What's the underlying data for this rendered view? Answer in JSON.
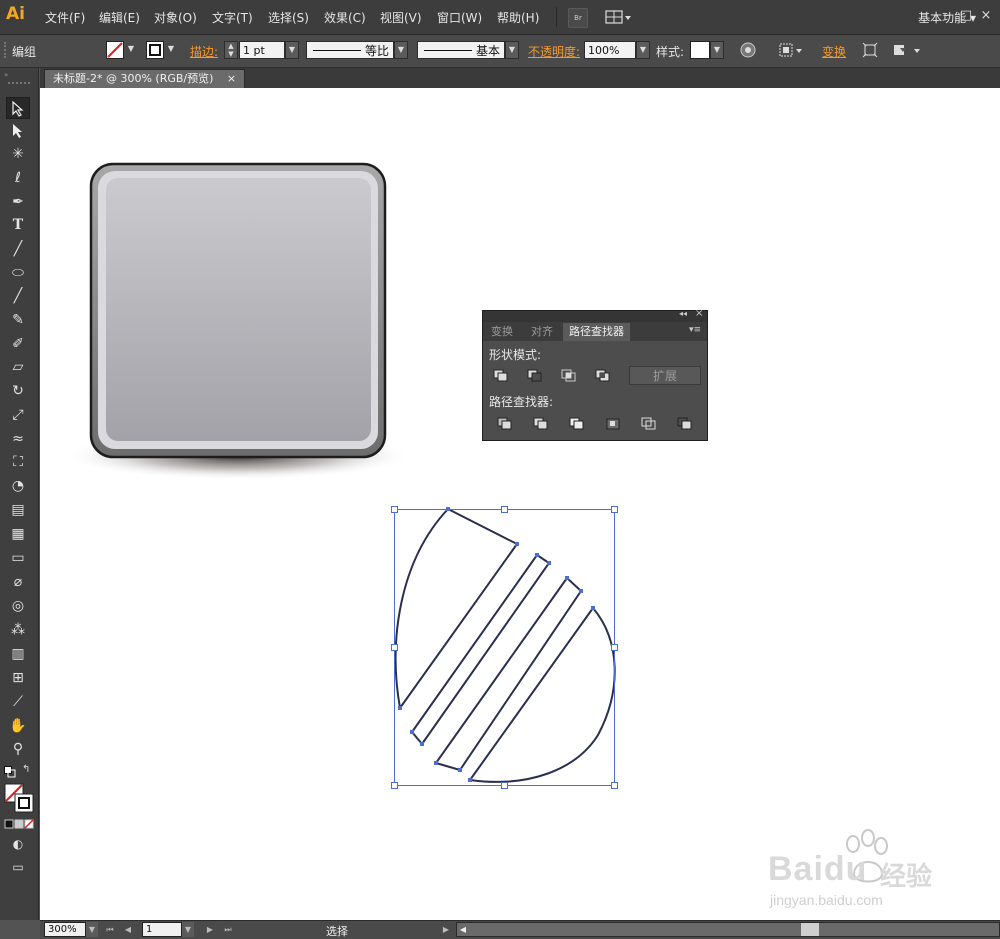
{
  "app": {
    "logo": "Ai",
    "workspace": "基本功能"
  },
  "menu": [
    "文件(F)",
    "编辑(E)",
    "对象(O)",
    "文字(T)",
    "选择(S)",
    "效果(C)",
    "视图(V)",
    "窗口(W)",
    "帮助(H)"
  ],
  "toolbar_icons": {
    "bridge": "Br",
    "arrange": "arrange-documents-icon"
  },
  "control": {
    "selection": "编组",
    "stroke_label": "描边:",
    "stroke_weight": "1 pt",
    "profile_ratio": "等比",
    "brush": "基本",
    "opacity_label": "不透明度:",
    "opacity_value": "100%",
    "style_label": "样式:",
    "transform_label": "变换"
  },
  "document": {
    "tab_title": "未标题-2* @ 300% (RGB/预览)",
    "close": "×"
  },
  "pathfinder_panel": {
    "tabs": [
      "变换",
      "对齐",
      "路径查找器"
    ],
    "active_tab": "路径查找器",
    "shape_modes_label": "形状模式:",
    "expand_label": "扩展",
    "pathfinders_label": "路径查找器:"
  },
  "status": {
    "zoom": "300%",
    "artboard": "1",
    "tool": "选择"
  },
  "watermark": {
    "brand": "Baidu",
    "brand_cn": "经验",
    "url": "jingyan.baidu.com"
  },
  "colors": {
    "accent_orange": "#f29a2e",
    "logo_orange": "#f5a623",
    "canvas": "#ffffff",
    "path_outline": "#2a2f4f",
    "bbox": "#4a6fd0"
  }
}
